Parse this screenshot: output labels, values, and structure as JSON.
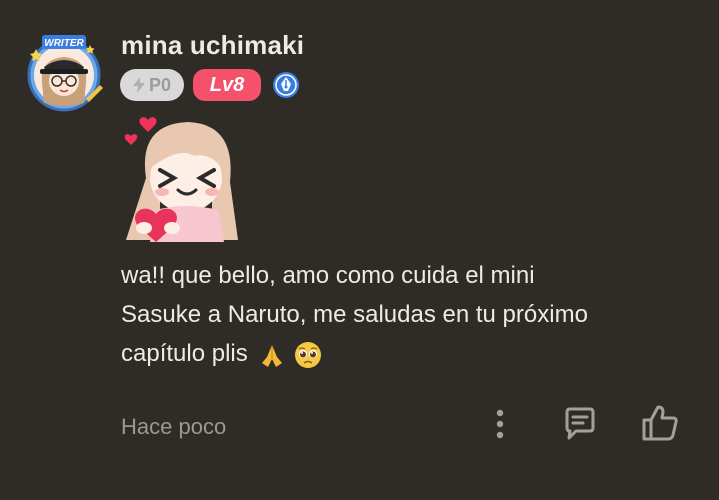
{
  "comment": {
    "username": "mina uchimaki",
    "avatar_badge": "WRITER",
    "points_label": "P0",
    "level_label": "Lv8",
    "text_line1": "wa!! que bello, amo como cuida el mini",
    "text_line2": "Sasuke a Naruto, me saludas en tu próximo",
    "text_line3": "capítulo plis",
    "emojis": [
      "folded-hands-icon",
      "pleading-face-icon"
    ],
    "timestamp": "Hace poco"
  },
  "actions": {
    "more_icon": "vertical-dots-icon",
    "reply_icon": "comment-icon",
    "like_icon": "thumbs-up-icon"
  },
  "colors": {
    "background": "#2f2c27",
    "level_badge": "#f4516b",
    "points_badge": "#d9d9d9",
    "writer_badge": "#3b7de0",
    "text": "#ecebe6",
    "muted": "#9c988f"
  }
}
